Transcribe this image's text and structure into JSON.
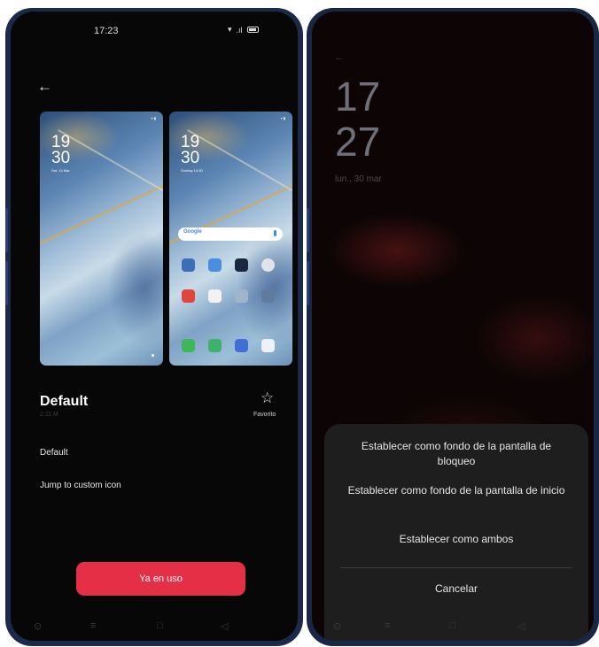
{
  "left_phone": {
    "status_time": "17:23",
    "title": "Default",
    "subtitle": "2.11 M",
    "favorite_label": "Favorito",
    "info_default": "Default",
    "jump_link": "Jump to custom icon",
    "use_button": "Ya en uso",
    "lock_preview": {
      "hour": "19",
      "minute": "30",
      "date": "Sat, 14 Mar"
    },
    "home_preview": {
      "hour": "19",
      "minute": "30",
      "date": "Sunday 14:30",
      "search_label": "Google"
    },
    "accent_color": "#e52f46"
  },
  "right_phone": {
    "lock_hour": "17",
    "lock_minute": "27",
    "lock_date": "lun., 30 mar",
    "sheet_options": {
      "lock": "Establecer como fondo de la pantalla de bloqueo",
      "home": "Establecer como fondo de la pantalla de inicio",
      "both": "Establecer como ambos",
      "cancel": "Cancelar"
    }
  },
  "icons": [
    "back-arrow-icon",
    "star-outline-icon",
    "google-mic-icon",
    "home-icon",
    "menu-icon",
    "recents-icon",
    "back-icon"
  ]
}
